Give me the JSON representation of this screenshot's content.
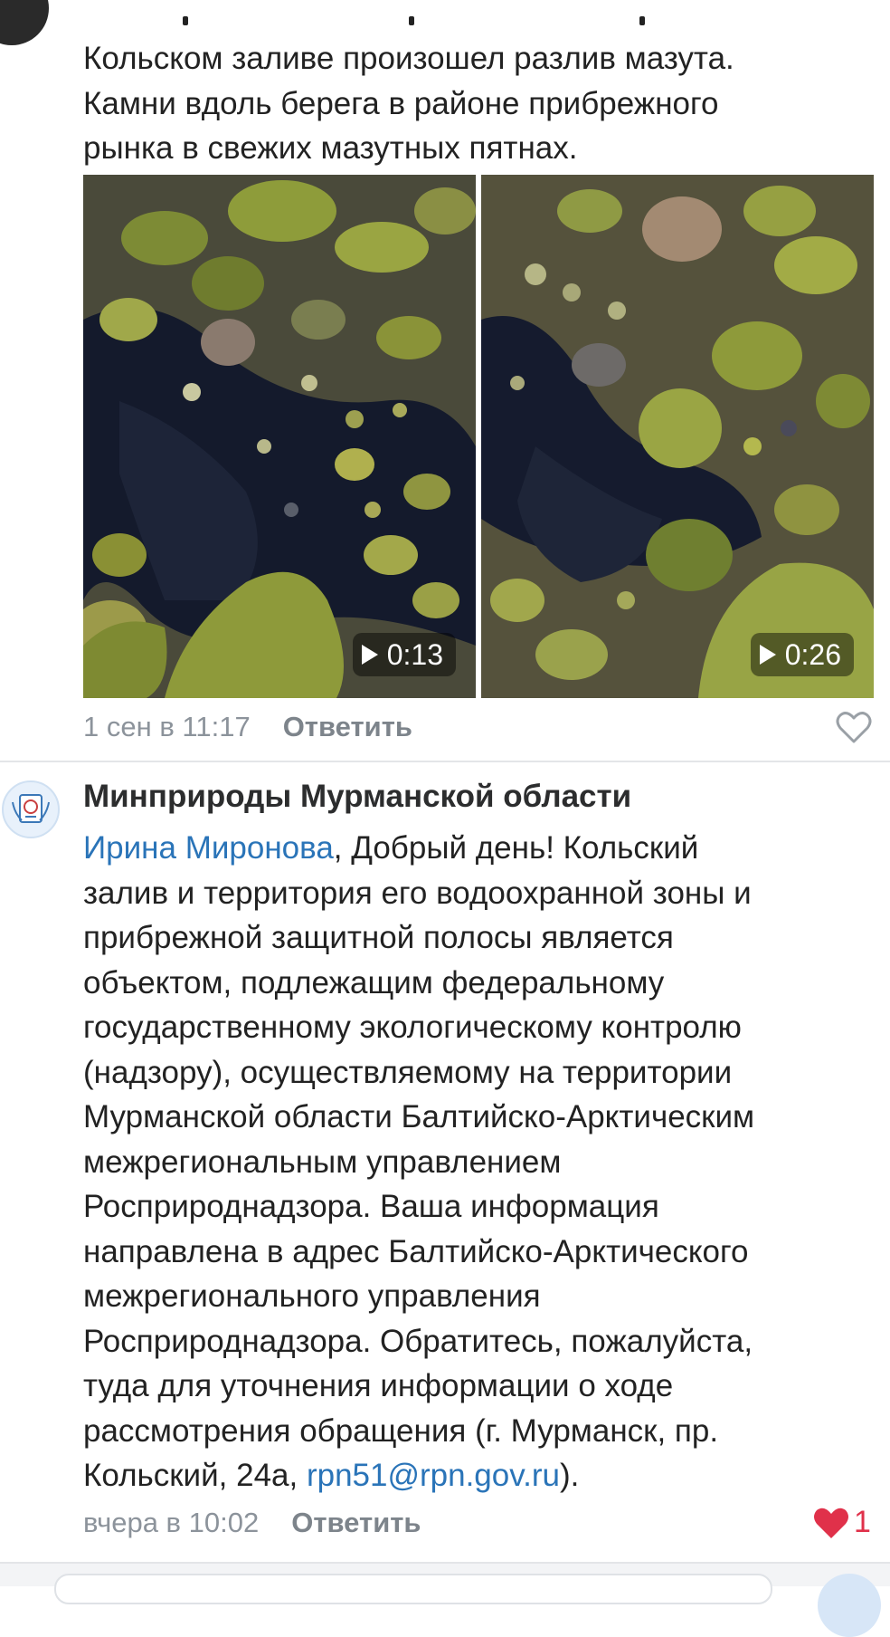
{
  "comment1": {
    "text": "Кольском заливе произошел разлив мазута.\nКамни вдоль берега в районе прибрежного\nрынка в свежих мазутных пятнах.",
    "videos": [
      {
        "duration": "0:13",
        "icon": "play-icon"
      },
      {
        "duration": "0:26",
        "icon": "play-icon"
      }
    ],
    "date": "1 сен в 11:17",
    "reply_label": "Ответить",
    "like_icon": "heart-outline-icon"
  },
  "comment2": {
    "author": "Минприроды Мурманской области",
    "mention": "Ирина Миронова",
    "text_main": ", Добрый день! Кольский\nзалив и территория его водоохранной зоны и\nприбрежной защитной полосы является\nобъектом, подлежащим федеральному\nгосударственному экологическому контролю\n(надзору), осуществляемому на территории\nМурманской области Балтийско-Арктическим\nмежрегиональным управлением\nРосприроднадзора. Ваша информация\nнаправлена в адрес Балтийско-Арктического\nмежрегионального управления\nРосприроднадзора. Обратитесь, пожалуйста,\nтуда для уточнения информации о ходе\nрассмотрения обращения (г. Мурманск, пр.\nКольский, 24а, ",
    "email": "rpn51@rpn.gov.ru",
    "text_end": ").",
    "date": "вчера в 10:02",
    "reply_label": "Ответить",
    "like_count": "1",
    "like_icon": "heart-filled-icon"
  },
  "colors": {
    "link": "#2a74b8",
    "meta": "#8c939b",
    "like_active": "#e0314a"
  }
}
